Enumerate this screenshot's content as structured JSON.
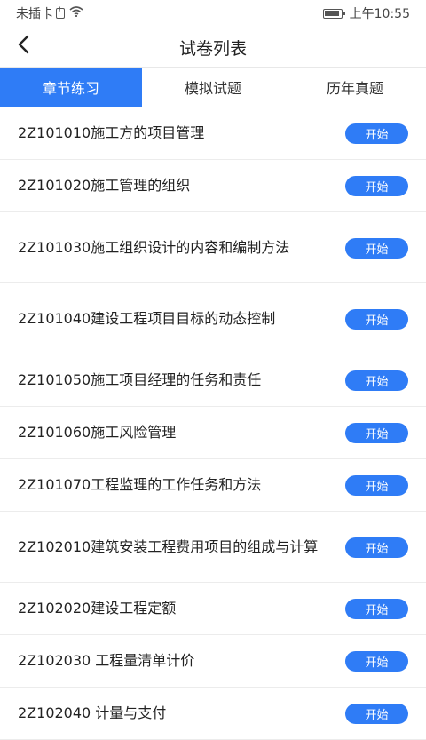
{
  "status_bar": {
    "carrier": "未插卡",
    "time": "上午10:55"
  },
  "nav": {
    "title": "试卷列表"
  },
  "tabs": [
    {
      "label": "章节练习",
      "active": true
    },
    {
      "label": "模拟试题",
      "active": false
    },
    {
      "label": "历年真题",
      "active": false
    }
  ],
  "items": [
    {
      "title": "2Z101010施工方的项目管理",
      "button": "开始"
    },
    {
      "title": "2Z101020施工管理的组织",
      "button": "开始"
    },
    {
      "title": "2Z101030施工组织设计的内容和编制方法",
      "button": "开始"
    },
    {
      "title": "2Z101040建设工程项目目标的动态控制",
      "button": "开始"
    },
    {
      "title": "2Z101050施工项目经理的任务和责任",
      "button": "开始"
    },
    {
      "title": "2Z101060施工风险管理",
      "button": "开始"
    },
    {
      "title": "2Z101070工程监理的工作任务和方法",
      "button": "开始"
    },
    {
      "title": "2Z102010建筑安装工程费用项目的组成与计算",
      "button": "开始"
    },
    {
      "title": "2Z102020建设工程定额",
      "button": "开始"
    },
    {
      "title": "2Z102030 工程量清单计价",
      "button": "开始"
    },
    {
      "title": "2Z102040 计量与支付",
      "button": "开始"
    }
  ],
  "colors": {
    "accent": "#2f7cf6"
  }
}
